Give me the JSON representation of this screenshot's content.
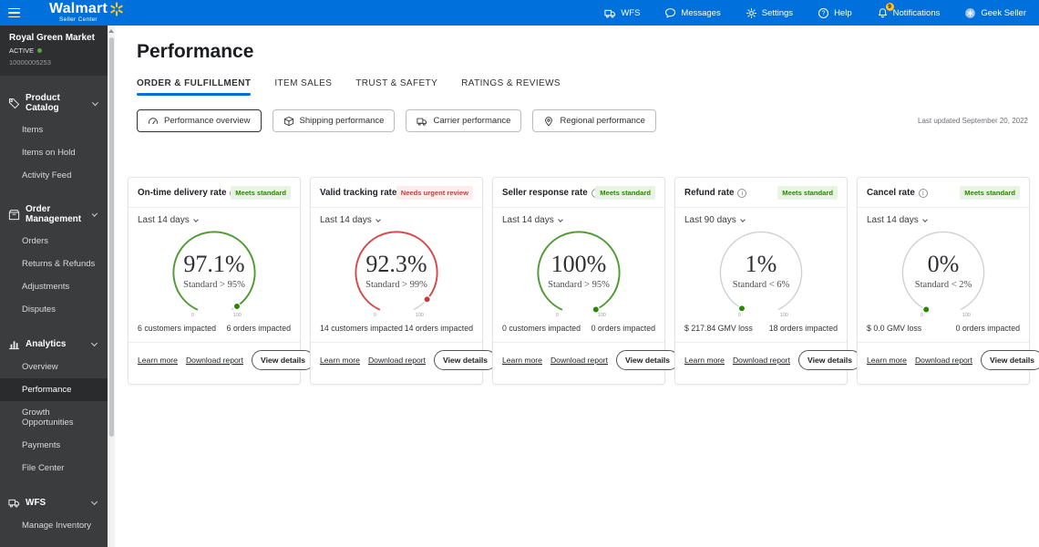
{
  "topbar": {
    "brand": "Walmart",
    "brand_sub": "Seller Center",
    "nav": [
      {
        "label": "WFS",
        "icon": "truck-icon"
      },
      {
        "label": "Messages",
        "icon": "chat-icon"
      },
      {
        "label": "Settings",
        "icon": "gear-icon"
      },
      {
        "label": "Help",
        "icon": "help-icon"
      },
      {
        "label": "Notifications",
        "icon": "bell-icon",
        "badge": "9"
      },
      {
        "label": "Geek Seller",
        "icon": "avatar-icon"
      }
    ]
  },
  "sidebar": {
    "account": {
      "name": "Royal Green Market",
      "status": "ACTIVE",
      "seller_id": "10000005253"
    },
    "sections": [
      {
        "label": "Product Catalog",
        "icon": "tag-icon",
        "items": [
          {
            "label": "Items"
          },
          {
            "label": "Items on Hold"
          },
          {
            "label": "Activity Feed"
          }
        ]
      },
      {
        "label": "Order Management",
        "icon": "package-icon",
        "items": [
          {
            "label": "Orders"
          },
          {
            "label": "Returns & Refunds"
          },
          {
            "label": "Adjustments"
          },
          {
            "label": "Disputes"
          }
        ]
      },
      {
        "label": "Analytics",
        "icon": "chart-icon",
        "items": [
          {
            "label": "Overview"
          },
          {
            "label": "Performance",
            "active": true
          },
          {
            "label": "Growth Opportunities"
          },
          {
            "label": "Payments"
          },
          {
            "label": "File Center"
          }
        ]
      },
      {
        "label": "WFS",
        "icon": "truck-icon",
        "items": [
          {
            "label": "Manage Inventory"
          }
        ]
      }
    ]
  },
  "main": {
    "title": "Performance",
    "tabs": [
      {
        "label": "ORDER & FULFILLMENT",
        "active": true
      },
      {
        "label": "ITEM SALES",
        "active": false
      },
      {
        "label": "TRUST & SAFETY",
        "active": false
      },
      {
        "label": "RATINGS & REVIEWS",
        "active": false
      }
    ],
    "filters": [
      {
        "label": "Performance overview",
        "icon": "gauge-icon",
        "selected": true
      },
      {
        "label": "Shipping performance",
        "icon": "box-icon",
        "selected": false
      },
      {
        "label": "Carrier performance",
        "icon": "truck-icon",
        "selected": false
      },
      {
        "label": "Regional performance",
        "icon": "pin-icon",
        "selected": false
      }
    ],
    "last_updated": "Last updated September 20, 2022"
  },
  "cards": [
    {
      "title": "On-time delivery rate",
      "badge": "Meets standard",
      "badge_type": "ok",
      "period": "Last 14 days",
      "value": "97.1%",
      "value_num": 97.1,
      "standard": "Standard > 95%",
      "status_color": "green",
      "left_stat": "6 customers impacted",
      "right_stat": "6 orders impacted",
      "learn_more": "Learn more",
      "download_report": "Download report",
      "view_details": "View details",
      "scale_min": "0",
      "scale_max": "100"
    },
    {
      "title": "Valid tracking rate",
      "badge": "Needs urgent review",
      "badge_type": "alert",
      "period": "Last 14 days",
      "value": "92.3%",
      "value_num": 92.3,
      "standard": "Standard > 99%",
      "status_color": "red",
      "left_stat": "14 customers impacted",
      "right_stat": "14 orders impacted",
      "learn_more": "Learn more",
      "download_report": "Download report",
      "view_details": "View details",
      "scale_min": "0",
      "scale_max": "100"
    },
    {
      "title": "Seller response rate",
      "badge": "Meets standard",
      "badge_type": "ok",
      "period": "Last 14 days",
      "value": "100%",
      "value_num": 100,
      "standard": "Standard > 95%",
      "status_color": "green",
      "left_stat": "0 customers impacted",
      "right_stat": "0 orders impacted",
      "learn_more": "Learn more",
      "download_report": "Download report",
      "view_details": "View details",
      "scale_min": "0",
      "scale_max": "100"
    },
    {
      "title": "Refund rate",
      "badge": "Meets standard",
      "badge_type": "ok",
      "period": "Last 90 days",
      "value": "1%",
      "value_num": 1,
      "standard": "Standard < 6%",
      "status_color": "neutral",
      "left_stat": "$ 217.84 GMV loss",
      "right_stat": "18 orders impacted",
      "learn_more": "Learn more",
      "download_report": "Download report",
      "view_details": "View details",
      "scale_min": "0",
      "scale_max": "100"
    },
    {
      "title": "Cancel rate",
      "badge": "Meets standard",
      "badge_type": "ok",
      "period": "Last 14 days",
      "value": "0%",
      "value_num": 0,
      "standard": "Standard < 2%",
      "status_color": "neutral",
      "left_stat": "$ 0.0 GMV loss",
      "right_stat": "0 orders impacted",
      "learn_more": "Learn more",
      "download_report": "Download report",
      "view_details": "View details",
      "scale_min": "0",
      "scale_max": "100"
    }
  ],
  "chart_data": {
    "type": "gauge-set",
    "gauges": [
      {
        "title": "On-time delivery rate",
        "value": 97.1,
        "standard": "> 95%",
        "range": [
          0,
          100
        ],
        "status": "meets standard",
        "period": "Last 14 days"
      },
      {
        "title": "Valid tracking rate",
        "value": 92.3,
        "standard": "> 99%",
        "range": [
          0,
          100
        ],
        "status": "needs urgent review",
        "period": "Last 14 days"
      },
      {
        "title": "Seller response rate",
        "value": 100,
        "standard": "> 95%",
        "range": [
          0,
          100
        ],
        "status": "meets standard",
        "period": "Last 14 days"
      },
      {
        "title": "Refund rate",
        "value": 1,
        "standard": "< 6%",
        "range": [
          0,
          100
        ],
        "status": "meets standard",
        "period": "Last 90 days"
      },
      {
        "title": "Cancel rate",
        "value": 0,
        "standard": "< 2%",
        "range": [
          0,
          100
        ],
        "status": "meets standard",
        "period": "Last 14 days"
      }
    ]
  },
  "colors": {
    "brand_blue": "#0071dc",
    "spark_yellow": "#ffc220",
    "success_green": "#2a8703",
    "alert_red": "#c0413d",
    "arc_green": "#4f9a35",
    "arc_red": "#d5494d",
    "arc_gray": "#cfd0d2"
  }
}
